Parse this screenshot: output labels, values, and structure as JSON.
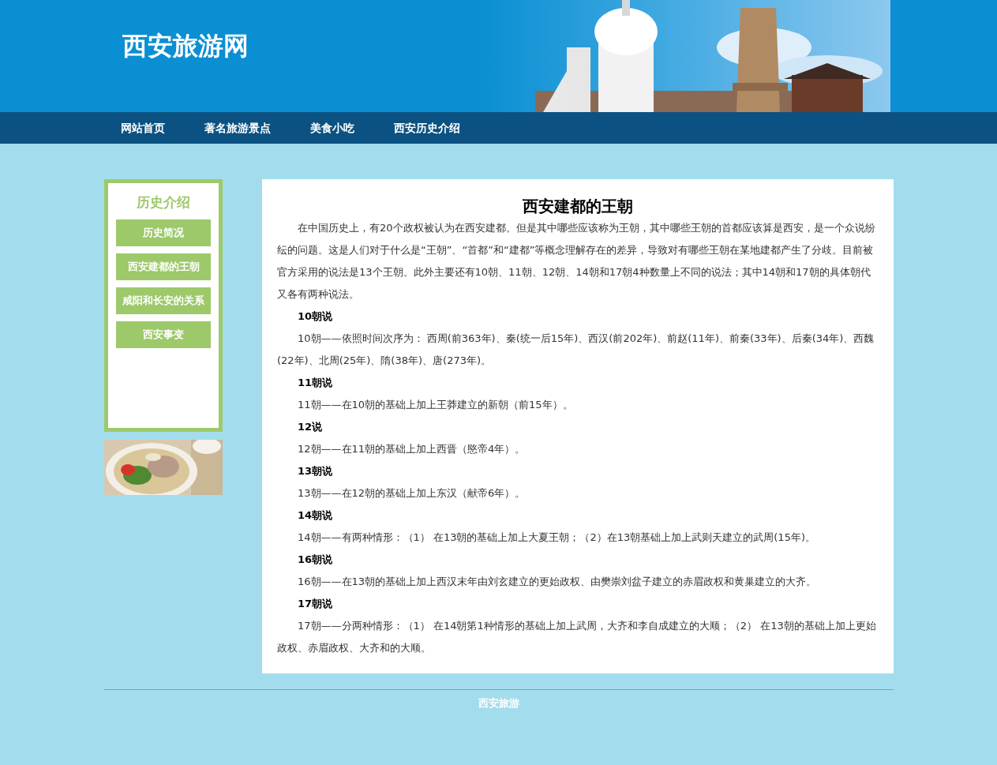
{
  "header": {
    "logo": "西安旅游网"
  },
  "nav": [
    "网站首页",
    "著名旅游景点",
    "美食小吃",
    "西安历史介绍"
  ],
  "sidebar": {
    "title": "历史介绍",
    "items": [
      "历史简况",
      "西安建都的王朝",
      "咸阳和长安的关系",
      "西安事变"
    ]
  },
  "article": {
    "title": "西安建都的王朝",
    "blocks": [
      {
        "kind": "paragraph",
        "text": "在中国历史上，有20个政权被认为在西安建都。但是其中哪些应该称为王朝，其中哪些王朝的首都应该算是西安，是一个众说纷纭的问题。这是人们对于什么是“王朝”、“首都”和“建都”等概念理解存在的差异，导致对有哪些王朝在某地建都产生了分歧。目前被官方采用的说法是13个王朝。此外主要还有10朝、11朝、12朝、14朝和17朝4种数量上不同的说法；其中14朝和17朝的具体朝代又各有两种说法。"
      },
      {
        "kind": "heading",
        "text": "10朝说"
      },
      {
        "kind": "paragraph",
        "text": "10朝——依照时间次序为： 西周(前363年)、秦(统一后15年)、西汉(前202年)、前赵(11年)、前秦(33年)、后秦(34年)、西魏(22年)、北周(25年)、隋(38年)、唐(273年)。"
      },
      {
        "kind": "heading",
        "text": "11朝说"
      },
      {
        "kind": "paragraph",
        "text": "11朝——在10朝的基础上加上王莽建立的新朝（前15年）。"
      },
      {
        "kind": "heading",
        "text": "12说"
      },
      {
        "kind": "paragraph",
        "text": "12朝——在11朝的基础上加上西晋（愍帝4年）。"
      },
      {
        "kind": "heading",
        "text": "13朝说"
      },
      {
        "kind": "paragraph",
        "text": "13朝——在12朝的基础上加上东汉（献帝6年）。"
      },
      {
        "kind": "heading",
        "text": "14朝说"
      },
      {
        "kind": "paragraph",
        "text": "14朝——有两种情形：（1） 在13朝的基础上加上大夏王朝；（2）在13朝基础上加上武则天建立的武周(15年)。"
      },
      {
        "kind": "heading",
        "text": "16朝说"
      },
      {
        "kind": "paragraph",
        "text": "16朝——在13朝的基础上加上西汉末年由刘玄建立的更始政权、由樊崇刘盆子建立的赤眉政权和黄巢建立的大齐。"
      },
      {
        "kind": "heading",
        "text": "17朝说"
      },
      {
        "kind": "paragraph",
        "text": "17朝——分两种情形：（1） 在14朝第1种情形的基础上加上武周，大齐和李自成建立的大顺；（2） 在13朝的基础上加上更始政权、赤眉政权、大齐和的大顺。"
      }
    ]
  },
  "footer": "西安旅游"
}
